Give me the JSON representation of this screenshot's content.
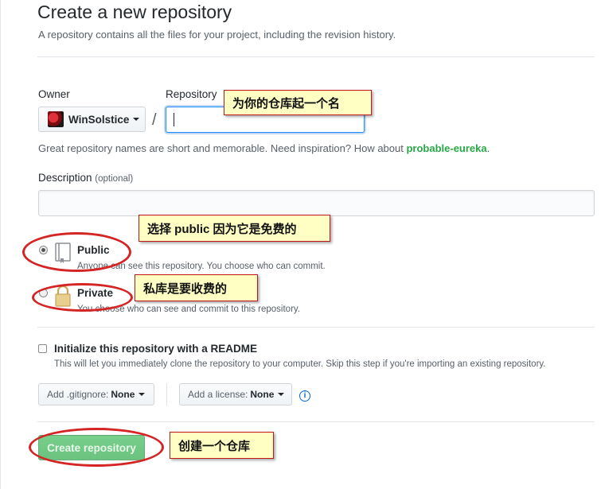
{
  "header": {
    "title": "Create a new repository",
    "subtitle": "A repository contains all the files for your project, including the revision history."
  },
  "owner": {
    "label": "Owner",
    "value": "WinSolstice"
  },
  "repository": {
    "label": "Repository",
    "value": ""
  },
  "hint": {
    "prefix": "Great repository names are short and memorable. Need inspiration? How about ",
    "suggestion": "probable-eureka",
    "suffix": "."
  },
  "description": {
    "label": "Description",
    "optional": "(optional)",
    "value": ""
  },
  "visibility": {
    "public": {
      "label": "Public",
      "note": "Anyone can see this repository. You choose who can commit.",
      "selected": true
    },
    "private": {
      "label": "Private",
      "note": "You choose who can see and commit to this repository.",
      "selected": false
    }
  },
  "readme": {
    "label": "Initialize this repository with a README",
    "note": "This will let you immediately clone the repository to your computer. Skip this step if you're importing an existing repository.",
    "checked": false
  },
  "gitignore": {
    "label": "Add .gitignore:",
    "value": "None"
  },
  "license": {
    "label": "Add a license:",
    "value": "None"
  },
  "create_button": "Create repository",
  "annotations": {
    "repo_name": "为你的仓库起一个名",
    "public": "选择 public 因为它是免费的",
    "private": "私库是要收费的",
    "create": "创建一个仓库"
  },
  "colors": {
    "annotation_border": "#c01818",
    "annotation_bg": "#ffffc4",
    "ellipse": "#d42424",
    "create_button": "#5fc777",
    "suggestion": "#28a745"
  }
}
